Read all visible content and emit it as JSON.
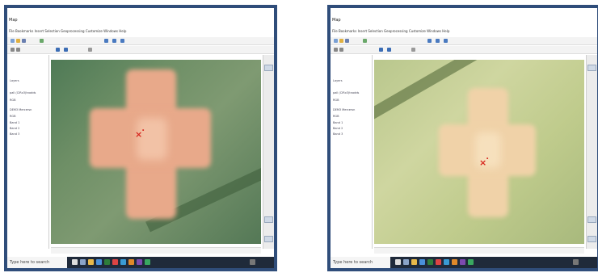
{
  "colors": {
    "frame_border": "#2f4d7a",
    "marker": "#d7271e",
    "canopy_left": "#e8a98a",
    "canopy_right": "#f0d2a8"
  },
  "screens": [
    {
      "title": "Map",
      "menu": "File  Bookmarks  Insert  Selection  Geoprocessing  Customize  Windows  Help",
      "search_placeholder": "Type here to search",
      "toc_items": [
        "Layers",
        "pall (CIRx3)tnodds",
        "RGB",
        "DEM3 Mercersn",
        "RGB",
        "Band 1",
        "Band 2",
        "Band 3"
      ],
      "marker_icon": "x-mark-icon"
    },
    {
      "title": "Map",
      "menu": "File  Bookmarks  Insert  Selection  Geoprocessing  Customize  Windows  Help",
      "search_placeholder": "Type here to search",
      "toc_items": [
        "Layers",
        "pall (CIRx3)tnodds",
        "RGB",
        "DEM3 Mercersn",
        "RGB",
        "Band 1",
        "Band 2",
        "Band 3"
      ],
      "marker_icon": "x-mark-icon"
    }
  ]
}
